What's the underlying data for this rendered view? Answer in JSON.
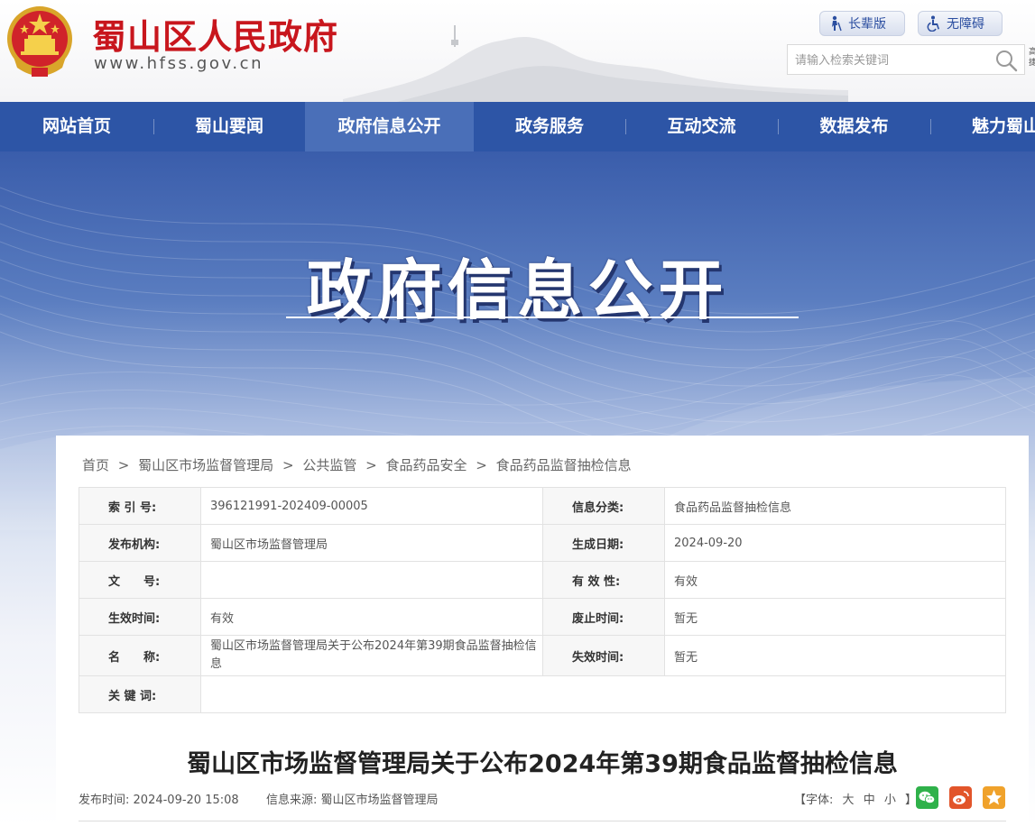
{
  "header": {
    "site_title": "蜀山区人民政府",
    "site_url": "www.hfss.gov.cn",
    "elder_label": "长辈版",
    "access_label": "无障碍",
    "search_placeholder": "请输入检索关键词",
    "edge_chars": "高 捷"
  },
  "nav": {
    "items": [
      {
        "label": "网站首页"
      },
      {
        "label": "蜀山要闻"
      },
      {
        "label": "政府信息公开"
      },
      {
        "label": "政务服务"
      },
      {
        "label": "互动交流"
      },
      {
        "label": "数据发布"
      },
      {
        "label": "魅力蜀山"
      }
    ],
    "active_index": 2
  },
  "banner": {
    "title": "政府信息公开"
  },
  "breadcrumb": [
    "首页",
    "蜀山区市场监督管理局",
    "公共监管",
    "食品药品安全",
    "食品药品监督抽检信息"
  ],
  "breadcrumb_separator": ">",
  "meta": {
    "rows": [
      {
        "l_label": "索 引 号:",
        "l_value": "396121991-202409-00005",
        "r_label": "信息分类:",
        "r_value": "食品药品监督抽检信息"
      },
      {
        "l_label": "发布机构:",
        "l_value": "蜀山区市场监督管理局",
        "r_label": "生成日期:",
        "r_value": "2024-09-20"
      },
      {
        "l_label": "文　　号:",
        "l_value": "",
        "r_label": "有 效 性:",
        "r_value": "有效"
      },
      {
        "l_label": "生效时间:",
        "l_value": "有效",
        "r_label": "废止时间:",
        "r_value": "暂无"
      },
      {
        "l_label": "名　　称:",
        "l_value": "蜀山区市场监督管理局关于公布2024年第39期食品监督抽检信息",
        "r_label": "失效时间:",
        "r_value": "暂无"
      }
    ],
    "keywords_label": "关 键 词:",
    "keywords_value": ""
  },
  "article": {
    "title": "蜀山区市场监督管理局关于公布2024年第39期食品监督抽检信息",
    "publish_time_label": "发布时间:",
    "publish_time": "2024-09-20 15:08",
    "source_label": "信息来源:",
    "source": "蜀山区市场监督管理局",
    "font_label_open": "【字体:",
    "font_large": "大",
    "font_medium": "中",
    "font_small": "小",
    "font_label_close": "】"
  },
  "colors": {
    "nav_bg": "#2d55a6",
    "nav_active": "#4a6fb8",
    "title_red": "#c8161d"
  }
}
